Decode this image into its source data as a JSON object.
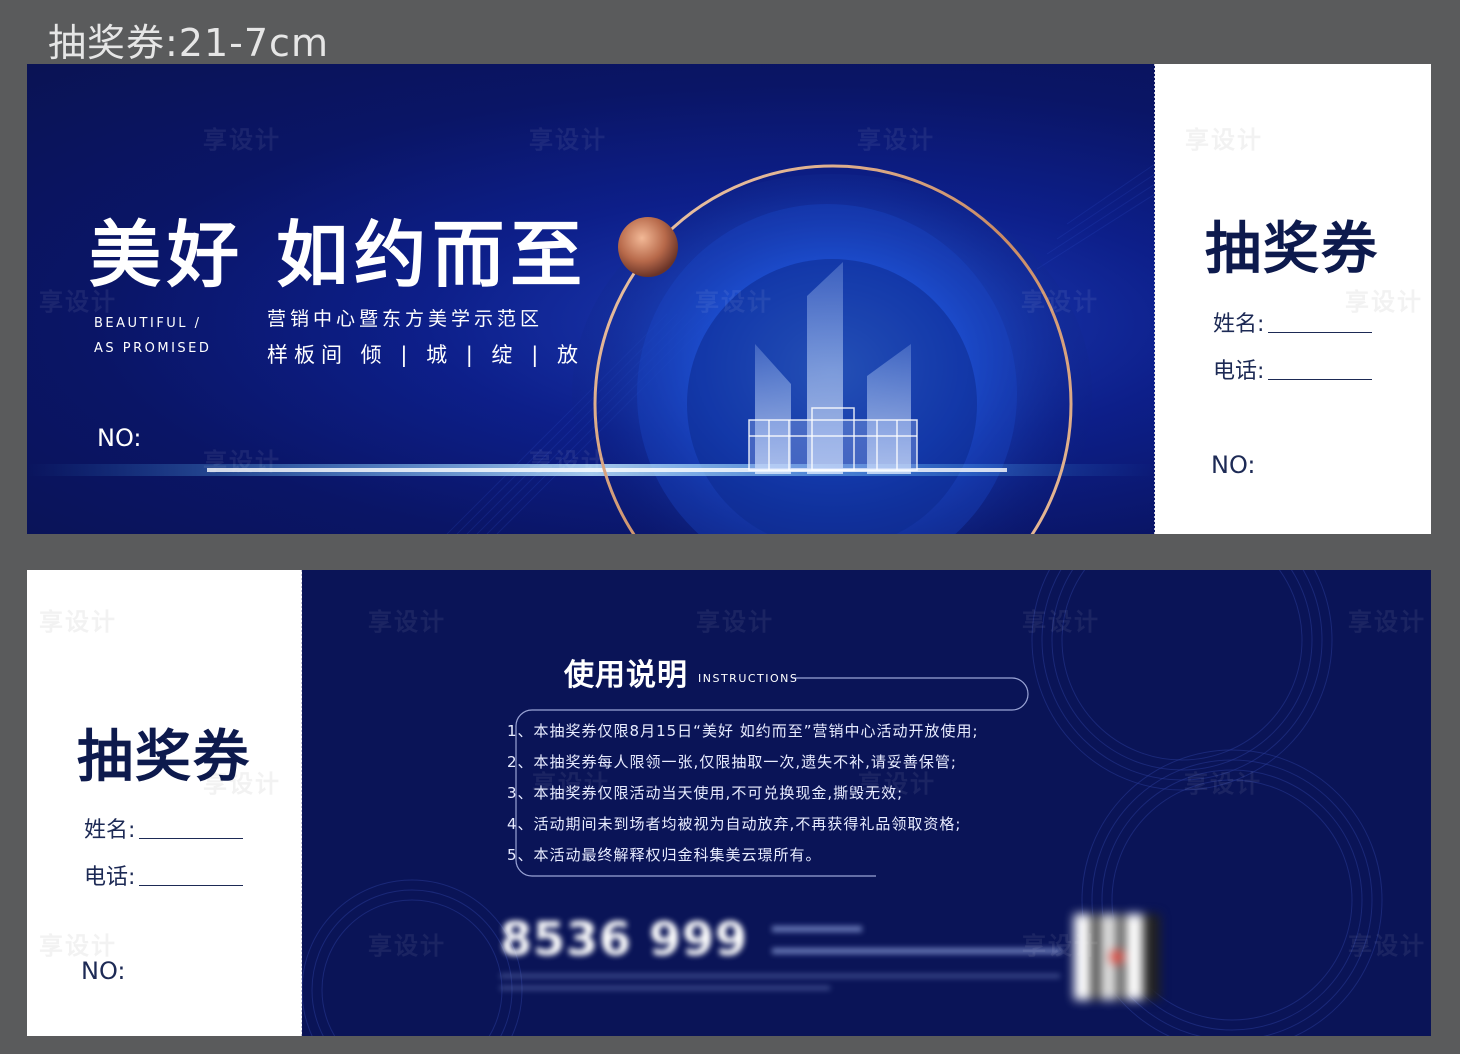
{
  "page_title": "抽奖券:21-7cm",
  "front": {
    "main_title": "美好 如约而至",
    "en_line_1": "BEAUTIFUL /",
    "en_line_2": "AS PROMISED",
    "sub_line_1": "营销中心暨东方美学示范区",
    "sub_line_2": "样板间   倾 | 城 | 绽 | 放",
    "no_label": "NO:"
  },
  "stub": {
    "title": "抽奖券",
    "name_label": "姓名:",
    "phone_label": "电话:",
    "no_label": "NO:"
  },
  "back": {
    "instr_title": "使用说明",
    "instr_en": "INSTRUCTIONS",
    "items": [
      "1、本抽奖券仅限8月15日“美好 如约而至”营销中心活动开放使用;",
      "2、本抽奖券每人限领一张,仅限抽取一次,遗失不补,请妥善保管;",
      "3、本抽奖券仅限活动当天使用,不可兑换现金,撕毁无效;",
      "4、活动期间未到场者均被视为自动放弃,不再获得礼品领取资格;",
      "5、本活动最终解释权归金科集美云璟所有。"
    ],
    "phone": "8536 999"
  },
  "watermark": "享设计",
  "colors": {
    "background": "#5a5b5c",
    "navy": "#0a1457",
    "accent_gold": "#d9a57a",
    "stub_text": "#0d1a4d"
  }
}
